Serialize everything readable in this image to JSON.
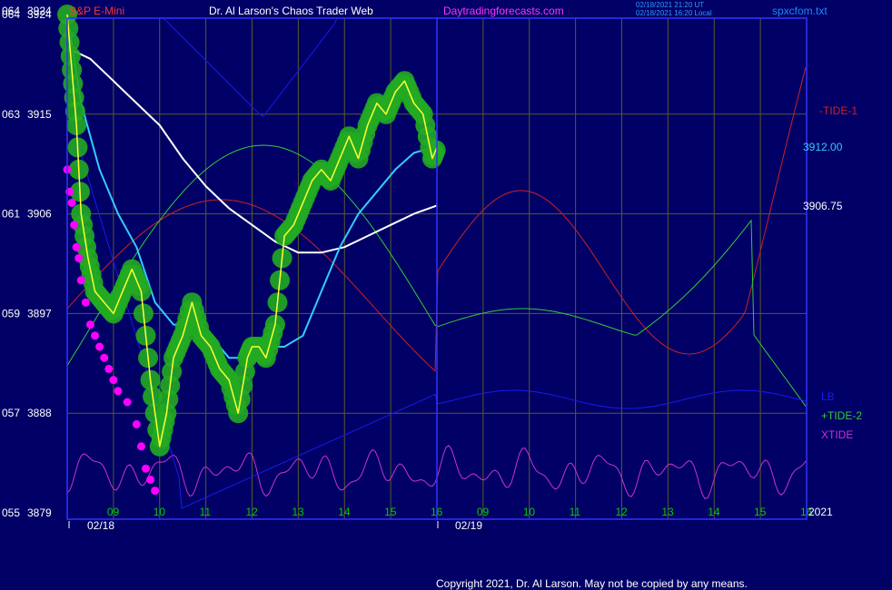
{
  "header": {
    "left_number": "064",
    "left_price": "3924",
    "symbol": "S&P E-Mini",
    "title": "Dr. Al Larson's Chaos Trader Web",
    "site": "Daytradingforecasts.com",
    "stamp_line1": "02/18/2021 21:20 UT",
    "stamp_line2": "02/18/2021 16:20 Local",
    "filename": "spxcfom.txt"
  },
  "copyright": "Copyright 2021, Dr. Al Larson. May not be copied by any means.",
  "colors": {
    "background": "#000066",
    "grid": "#5a5a2a",
    "frame": "#3333ff",
    "tide1": "#cc2222",
    "tide2": "#33cc33",
    "xtide": "#cc33cc",
    "lb": "#1a1aee",
    "white_ma": "#ffffff",
    "cyan_ma": "#33ccff",
    "price_band": "#22aa22",
    "price_line": "#ffff33",
    "forecast_dots": "#ff00ff"
  },
  "chart_data": {
    "type": "line",
    "y_axis": {
      "ticks": [
        {
          "code": "064",
          "price": "3924"
        },
        {
          "code": "063",
          "price": "3915"
        },
        {
          "code": "061",
          "price": "3906"
        },
        {
          "code": "059",
          "price": "3897"
        },
        {
          "code": "057",
          "price": "3888"
        },
        {
          "code": "055",
          "price": "3879"
        }
      ],
      "ylim": [
        3879,
        3924
      ]
    },
    "x_axis": {
      "day1_ticks": [
        "09",
        "10",
        "11",
        "12",
        "13",
        "14",
        "15",
        "16"
      ],
      "day2_ticks": [
        "09",
        "10",
        "11",
        "12",
        "13",
        "14",
        "15",
        "16"
      ],
      "day1_date": "02/18",
      "day2_date": "02/19",
      "year": "2021",
      "xlim": [
        8.0,
        16.0
      ]
    },
    "price_labels": [
      {
        "text": "3912.00",
        "price": 3912.0,
        "color": "#33ccff"
      },
      {
        "text": "3906.75",
        "price": 3906.75,
        "color": "#ffffff"
      }
    ],
    "legend": [
      {
        "name": "-TIDE-1",
        "color": "#cc2222"
      },
      {
        "name": "LB",
        "color": "#1a1aee"
      },
      {
        "name": "+TIDE-2",
        "color": "#33cc33"
      },
      {
        "name": "XTIDE",
        "color": "#cc33cc"
      }
    ],
    "price": {
      "x": [
        8.0,
        8.1,
        8.2,
        8.3,
        8.45,
        8.6,
        8.8,
        9.0,
        9.2,
        9.4,
        9.6,
        9.8,
        10.0,
        10.15,
        10.3,
        10.5,
        10.7,
        10.9,
        11.1,
        11.3,
        11.5,
        11.7,
        11.9,
        12.0,
        12.15,
        12.3,
        12.5,
        12.7,
        12.9,
        13.1,
        13.3,
        13.5,
        13.7,
        13.9,
        14.1,
        14.3,
        14.5,
        14.7,
        14.9,
        15.1,
        15.3,
        15.5,
        15.7,
        15.9,
        16.0
      ],
      "values": [
        3924,
        3919,
        3914,
        3906,
        3902,
        3899,
        3898,
        3897,
        3899,
        3901,
        3899,
        3891,
        3885,
        3888,
        3893,
        3895,
        3898,
        3895,
        3894,
        3892,
        3891,
        3888,
        3893,
        3894,
        3894,
        3893,
        3896,
        3904,
        3905,
        3907,
        3909,
        3910,
        3909,
        3911,
        3913,
        3911,
        3914,
        3916,
        3915,
        3917,
        3918,
        3916,
        3915,
        3911,
        3912
      ]
    },
    "cyan_average": {
      "x": [
        8.0,
        8.3,
        8.7,
        9.1,
        9.5,
        9.9,
        10.3,
        10.7,
        11.1,
        11.5,
        11.9,
        12.3,
        12.7,
        13.1,
        13.5,
        13.9,
        14.3,
        14.7,
        15.1,
        15.5,
        15.9,
        16.0
      ],
      "values": [
        3924,
        3916,
        3910,
        3906,
        3903,
        3898,
        3896,
        3896,
        3895,
        3893,
        3893,
        3894,
        3894,
        3895,
        3899,
        3903,
        3906,
        3908,
        3910,
        3911.5,
        3912,
        3912
      ]
    },
    "white_average": {
      "x": [
        8.0,
        8.5,
        9.0,
        9.5,
        10.0,
        10.5,
        11.0,
        11.5,
        12.0,
        12.5,
        13.0,
        13.5,
        14.0,
        14.5,
        15.0,
        15.5,
        16.0
      ],
      "values": [
        3921,
        3920,
        3918,
        3916,
        3914,
        3911,
        3908.5,
        3906.5,
        3905,
        3903.5,
        3902.5,
        3902.5,
        3903,
        3904,
        3905,
        3906,
        3906.75
      ]
    },
    "forecast_dots": {
      "x": [
        8.0,
        8.05,
        8.1,
        8.15,
        8.2,
        8.25,
        8.3,
        8.4,
        8.5,
        8.6,
        8.7,
        8.8,
        8.9,
        9.0,
        9.1,
        9.3,
        9.5,
        9.6,
        9.7,
        9.8,
        9.9
      ],
      "values": [
        3910,
        3908,
        3907,
        3905,
        3903,
        3902,
        3900,
        3898,
        3896,
        3895,
        3894,
        3893,
        3892,
        3891,
        3890,
        3889,
        3887,
        3885,
        3883,
        3882,
        3881
      ]
    }
  }
}
